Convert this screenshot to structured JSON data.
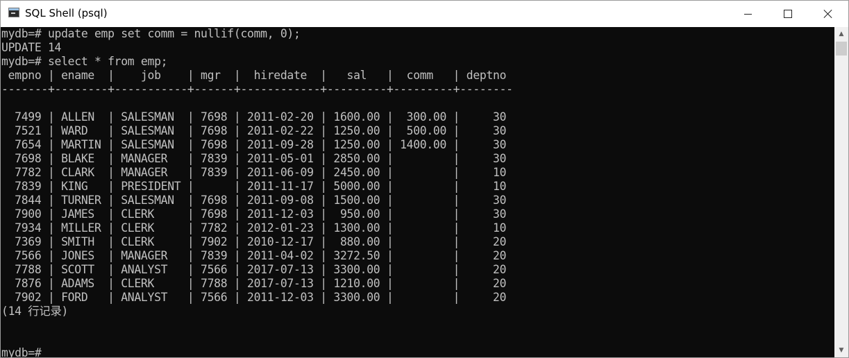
{
  "window": {
    "title": "SQL Shell (psql)"
  },
  "terminal": {
    "lines": [
      "mydb=# update emp set comm = nullif(comm, 0);",
      "UPDATE 14",
      "mydb=# select * from emp;",
      " empno | ename  |    job    | mgr  |  hiredate  |   sal   |  comm   | deptno",
      "-------+--------+-----------+------+------------+---------+---------+--------",
      "",
      "  7499 | ALLEN  | SALESMAN  | 7698 | 2011-02-20 | 1600.00 |  300.00 |     30",
      "  7521 | WARD   | SALESMAN  | 7698 | 2011-02-22 | 1250.00 |  500.00 |     30",
      "  7654 | MARTIN | SALESMAN  | 7698 | 2011-09-28 | 1250.00 | 1400.00 |     30",
      "  7698 | BLAKE  | MANAGER   | 7839 | 2011-05-01 | 2850.00 |         |     30",
      "  7782 | CLARK  | MANAGER   | 7839 | 2011-06-09 | 2450.00 |         |     10",
      "  7839 | KING   | PRESIDENT |      | 2011-11-17 | 5000.00 |         |     10",
      "  7844 | TURNER | SALESMAN  | 7698 | 2011-09-08 | 1500.00 |         |     30",
      "  7900 | JAMES  | CLERK     | 7698 | 2011-12-03 |  950.00 |         |     30",
      "  7934 | MILLER | CLERK     | 7782 | 2012-01-23 | 1300.00 |         |     10",
      "  7369 | SMITH  | CLERK     | 7902 | 2010-12-17 |  880.00 |         |     20",
      "  7566 | JONES  | MANAGER   | 7839 | 2011-04-02 | 3272.50 |         |     20",
      "  7788 | SCOTT  | ANALYST   | 7566 | 2017-07-13 | 3300.00 |         |     20",
      "  7876 | ADAMS  | CLERK     | 7788 | 2017-07-13 | 1210.00 |         |     20",
      "  7902 | FORD   | ANALYST   | 7566 | 2011-12-03 | 3300.00 |         |     20",
      "(14 行记录)",
      "",
      "",
      "mydb=#"
    ]
  },
  "icons": {
    "app": "terminal-app-icon",
    "minimize": "minimize-icon",
    "maximize": "maximize-icon",
    "close": "close-icon",
    "scroll_up": "scroll-up-arrow-icon",
    "scroll_down": "scroll-down-arrow-icon"
  },
  "colors": {
    "console_bg": "#0c0c0c",
    "console_fg": "#c0c0c0",
    "table_grid": "#8a5a2e"
  }
}
